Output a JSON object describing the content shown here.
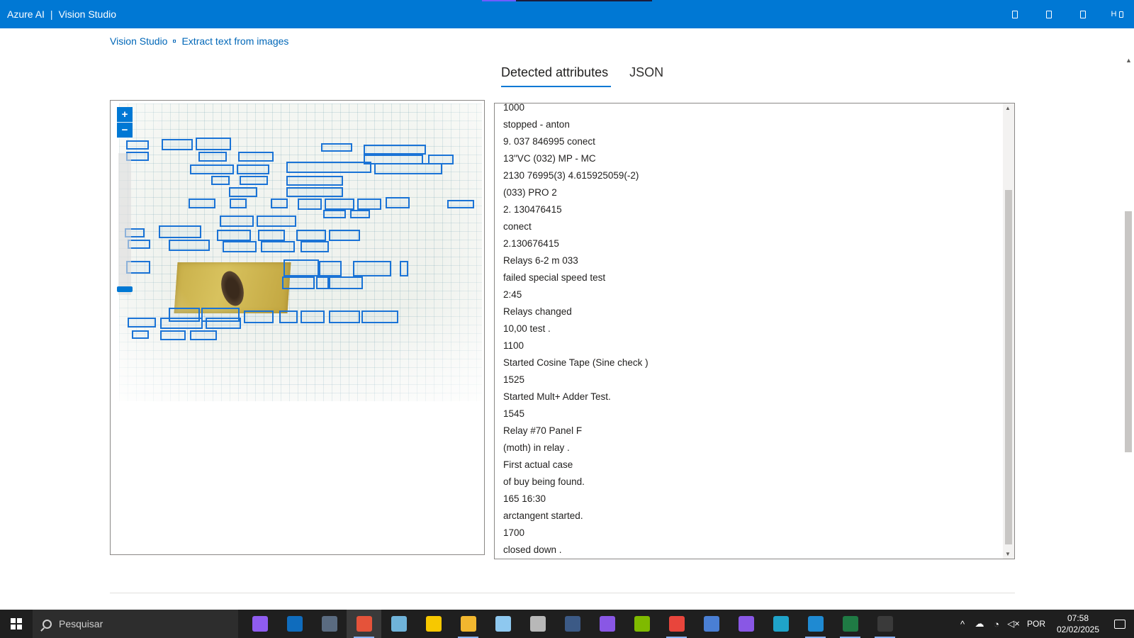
{
  "header": {
    "brand": "Azure AI",
    "separator": "|",
    "product": "Vision Studio",
    "right_icons": [
      "window-icon",
      "window-icon",
      "window-icon",
      "help-icon"
    ],
    "help_label": "H"
  },
  "breadcrumb": {
    "home": "Vision Studio",
    "current": "Extract text from images"
  },
  "tabs": [
    {
      "label": "Detected attributes",
      "active": true
    },
    {
      "label": "JSON",
      "active": false
    }
  ],
  "image_panel": {
    "zoom_in": "+",
    "zoom_out": "−"
  },
  "results": {
    "lines": [
      "1000",
      "stopped - anton",
      "9. 037 846995 conect",
      "13\"VC (032) MP - MC",
      "2130 76995(3) 4.615925059(-2)",
      "(033) PRO 2",
      "2. 130476415",
      "conect",
      "2.130676415",
      "Relays 6-2 m 033",
      "failed special speed test",
      "2:45",
      "Relays changed",
      "10,00 test .",
      "1100",
      "Started Cosine Tape (Sine check )",
      "1525",
      "Started Mult+ Adder Test.",
      "1545",
      "Relay #70 Panel F",
      "(moth) in relay .",
      "First actual case",
      "of buy being found.",
      "165 16:30",
      "arctangent started.",
      "1700",
      "closed down ."
    ]
  },
  "taskbar": {
    "search_placeholder": "Pesquisar",
    "apps": [
      {
        "name": "copilot-icon",
        "color": "#8f5cf0",
        "active": false,
        "running": false
      },
      {
        "name": "outlook-icon",
        "color": "#0f6cbd",
        "active": false,
        "running": false
      },
      {
        "name": "calculator-icon",
        "color": "#5a6b80",
        "active": false,
        "running": false
      },
      {
        "name": "snipping-tool-icon",
        "color": "#e5533a",
        "active": true,
        "running": true
      },
      {
        "name": "notepad-icon",
        "color": "#6fb3d9",
        "active": false,
        "running": false
      },
      {
        "name": "sticky-notes-icon",
        "color": "#f7c800",
        "active": false,
        "running": false
      },
      {
        "name": "file-explorer-icon",
        "color": "#f2b72f",
        "active": false,
        "running": true
      },
      {
        "name": "3d-viewer-icon",
        "color": "#8ec8ef",
        "active": false,
        "running": false
      },
      {
        "name": "database-icon",
        "color": "#b8b8b8",
        "active": false,
        "running": false
      },
      {
        "name": "sql-server-icon",
        "color": "#3c5a86",
        "active": false,
        "running": false
      },
      {
        "name": "visual-studio-icon",
        "color": "#8957e5",
        "active": false,
        "running": false
      },
      {
        "name": "excel-tool-icon",
        "color": "#7fba00",
        "active": false,
        "running": false
      },
      {
        "name": "chrome-icon",
        "color": "#e8453c",
        "active": false,
        "running": true
      },
      {
        "name": "remote-desktop-icon",
        "color": "#4a7fd4",
        "active": false,
        "running": false
      },
      {
        "name": "visual-studio-2-icon",
        "color": "#8957e5",
        "active": false,
        "running": false
      },
      {
        "name": "edge-icon",
        "color": "#1fa3c9",
        "active": false,
        "running": false
      },
      {
        "name": "vscode-icon",
        "color": "#1f8ad2",
        "active": false,
        "running": true
      },
      {
        "name": "excel-icon",
        "color": "#1f7a44",
        "active": false,
        "running": true
      },
      {
        "name": "terminal-icon",
        "color": "#3a3a3a",
        "active": false,
        "running": true
      }
    ],
    "language": "POR",
    "time": "07:58",
    "date": "02/02/2025"
  }
}
